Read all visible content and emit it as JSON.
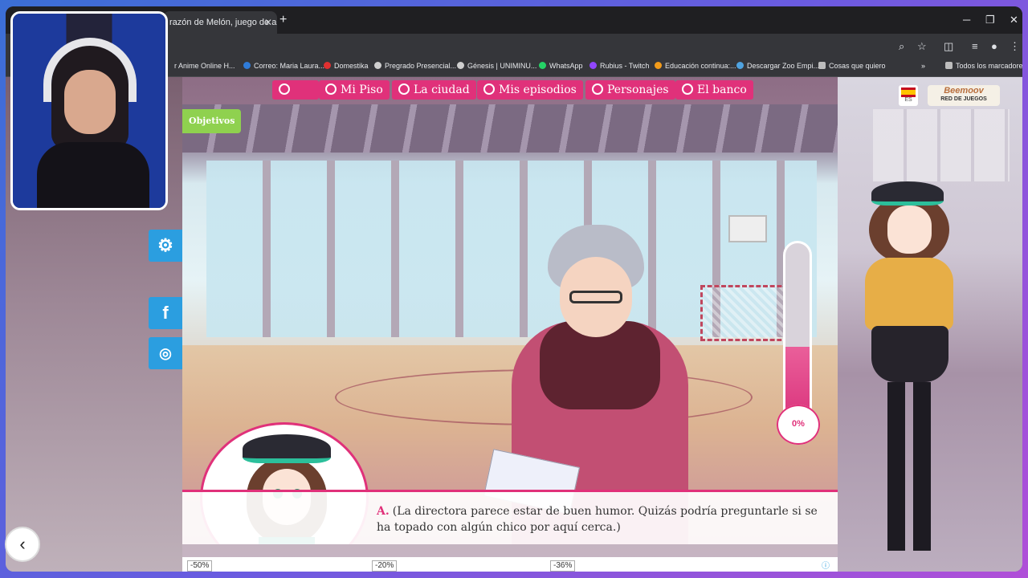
{
  "browser": {
    "tab_title": "razón de Melón, juego de ar",
    "tab_close": "✕",
    "new_tab": "+",
    "window_controls": {
      "minimize": "─",
      "restore": "❐",
      "close": "✕"
    },
    "bookmarks": [
      {
        "label": "r Anime Online H...",
        "color": "#e0e0e0"
      },
      {
        "label": "Correo: Maria Laura...",
        "color": "#2f7bd8"
      },
      {
        "label": "Domestika",
        "color": "#e03030"
      },
      {
        "label": "Pregrado Presencial...",
        "color": "#cfcfcf"
      },
      {
        "label": "Génesis | UNIMINU...",
        "color": "#cfcfcf"
      },
      {
        "label": "WhatsApp",
        "color": "#25d366"
      },
      {
        "label": "Rubius - Twitch",
        "color": "#9146ff"
      },
      {
        "label": "Educación continua:...",
        "color": "#f29b1a"
      },
      {
        "label": "Descargar Zoo Empi...",
        "color": "#4fa3e0"
      },
      {
        "label": "Cosas que quiero",
        "color": "#bdbdbd"
      },
      {
        "label": "Todos los marcadores",
        "color": "#bdbdbd"
      }
    ]
  },
  "game": {
    "nav": [
      {
        "label": "Mi Piso"
      },
      {
        "label": "La ciudad"
      },
      {
        "label": "Mis episodios"
      },
      {
        "label": "Personajes"
      },
      {
        "label": "El banco"
      }
    ],
    "objectives_label": "Objetivos",
    "language_code": "ES",
    "network_brand": "Beemoov",
    "network_sub": "RED DE JUEGOS",
    "love_meter": {
      "percent_text": "0%",
      "fill_fraction": 0.45
    },
    "dialog": {
      "speaker": "A.",
      "text": "(La directora parece estar de buen humor. Quizás podría preguntarle si se ha topado con algún chico por aquí cerca.)"
    },
    "ads": [
      "-50%",
      "-20%",
      "-36%"
    ]
  },
  "colors": {
    "accent": "#e0317a",
    "objectives": "#8fd14f",
    "facebook": "#2b9ee0",
    "instagram": "#2b9ee0",
    "settings": "#2b9ee0"
  },
  "icons": {
    "settings": "gear-icon",
    "facebook": "facebook-icon",
    "instagram": "instagram-icon",
    "back": "chevron-left-icon"
  }
}
